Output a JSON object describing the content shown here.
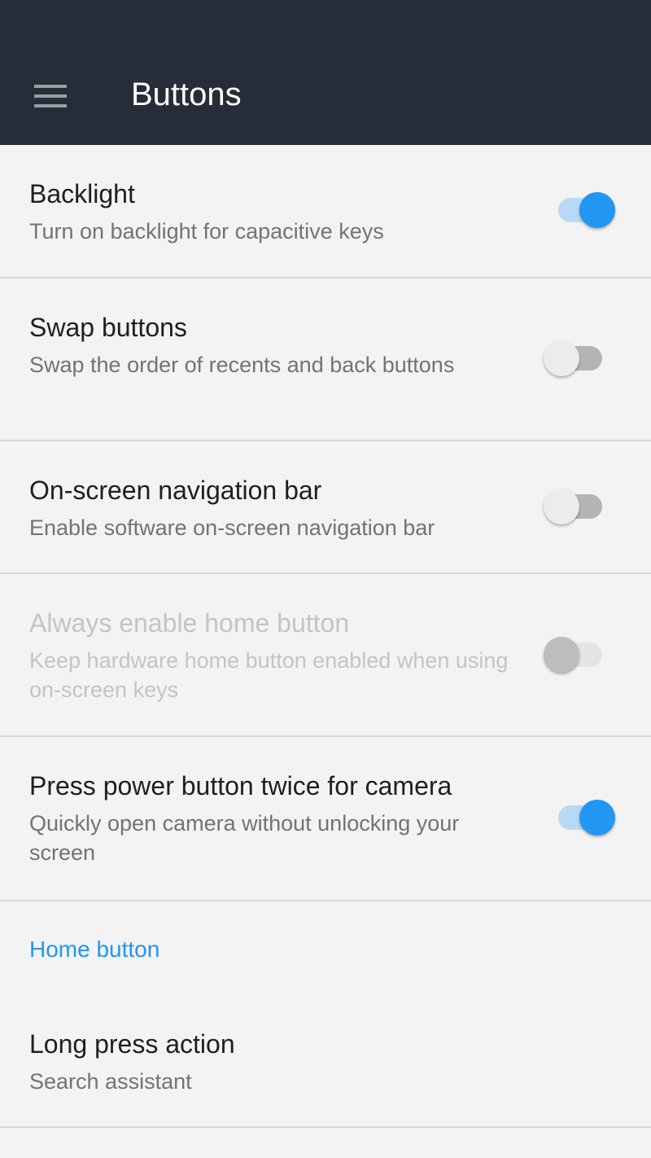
{
  "app_bar": {
    "title": "Buttons",
    "menu_icon": "hamburger-menu-icon"
  },
  "colors": {
    "accent": "#2196f3",
    "app_bar": "#262d38"
  },
  "settings": [
    {
      "title": "Backlight",
      "summary": "Turn on backlight for capacitive keys",
      "checked": true,
      "enabled": true
    },
    {
      "title": "Swap buttons",
      "summary": "Swap the order of recents and back buttons",
      "checked": false,
      "enabled": true
    },
    {
      "title": "On-screen navigation bar",
      "summary": "Enable software on-screen navigation bar",
      "checked": false,
      "enabled": true
    },
    {
      "title": "Always enable home button",
      "summary": "Keep hardware home button enabled when using on-screen keys",
      "checked": false,
      "enabled": false
    },
    {
      "title": "Press power button twice for camera",
      "summary": "Quickly open camera without unlocking your screen",
      "checked": true,
      "enabled": true
    }
  ],
  "category": {
    "title": "Home button"
  },
  "long_press": {
    "title": "Long press action",
    "summary": "Search assistant"
  }
}
